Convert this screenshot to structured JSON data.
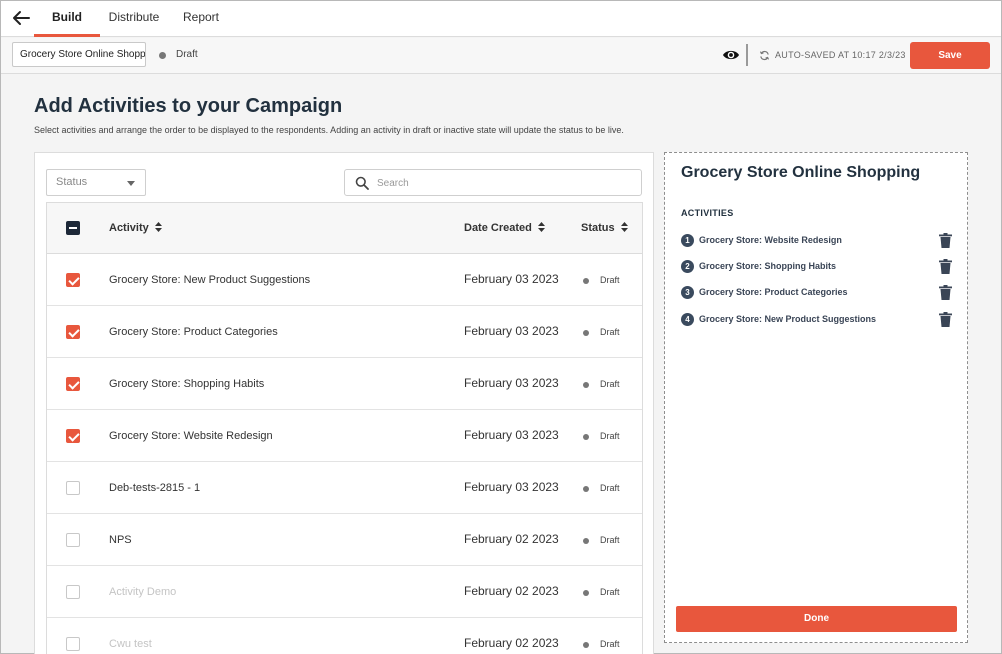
{
  "nav": {
    "tabs": [
      {
        "label": "Build"
      },
      {
        "label": "Distribute"
      },
      {
        "label": "Report"
      }
    ]
  },
  "toolbar": {
    "campaign_name": "Grocery Store Online Shopping",
    "status": "Draft",
    "autosave": "AUTO-SAVED AT 10:17 2/3/23",
    "save_label": "Save"
  },
  "page": {
    "title": "Add Activities to your Campaign",
    "subtitle": "Select activities and arrange the order to be displayed to the respondents. Adding an activity in draft or inactive state will update the status to be live."
  },
  "filters": {
    "status_label": "Status",
    "search_placeholder": "Search"
  },
  "table": {
    "columns": [
      "Activity",
      "Date Created",
      "Status"
    ],
    "rows": [
      {
        "activity": "Grocery Store: New Product Suggestions",
        "date": "February 03 2023",
        "status": "Draft",
        "checked": true,
        "dim": false
      },
      {
        "activity": "Grocery Store: Product Categories",
        "date": "February 03 2023",
        "status": "Draft",
        "checked": true,
        "dim": false
      },
      {
        "activity": "Grocery Store: Shopping Habits",
        "date": "February 03 2023",
        "status": "Draft",
        "checked": true,
        "dim": false
      },
      {
        "activity": "Grocery Store: Website Redesign",
        "date": "February 03 2023",
        "status": "Draft",
        "checked": true,
        "dim": false
      },
      {
        "activity": "Deb-tests-2815 - 1",
        "date": "February 03 2023",
        "status": "Draft",
        "checked": false,
        "dim": false
      },
      {
        "activity": "NPS",
        "date": "February 02 2023",
        "status": "Draft",
        "checked": false,
        "dim": false
      },
      {
        "activity": "Activity Demo",
        "date": "February 02 2023",
        "status": "Draft",
        "checked": false,
        "dim": true
      },
      {
        "activity": "Cwu test",
        "date": "February 02 2023",
        "status": "Draft",
        "checked": false,
        "dim": true
      }
    ]
  },
  "selected_panel": {
    "title": "Grocery Store Online Shopping",
    "section_label": "ACTIVITIES",
    "items": [
      {
        "num": "1",
        "label": "Grocery Store: Website Redesign"
      },
      {
        "num": "2",
        "label": "Grocery Store: Shopping Habits"
      },
      {
        "num": "3",
        "label": "Grocery Store: Product Categories"
      },
      {
        "num": "4",
        "label": "Grocery Store: New Product Suggestions"
      }
    ],
    "done_label": "Done"
  },
  "colors": {
    "accent": "#e8573d",
    "heading": "#22313f",
    "checkbox_header": "#1d2838",
    "status_dot": "#777777"
  },
  "icons": [
    "arrow-left-icon",
    "eye-icon",
    "sync-icon",
    "caret-down-icon",
    "search-icon",
    "sort-icon",
    "trash-icon"
  ]
}
